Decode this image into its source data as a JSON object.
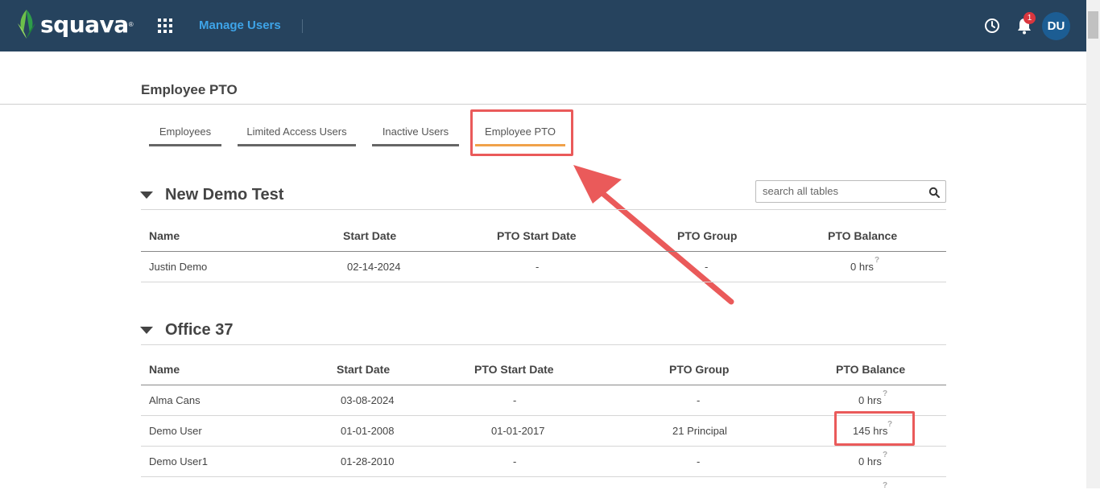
{
  "header": {
    "brand": "squava",
    "nav_label": "Manage Users",
    "notification_count": "1",
    "avatar_initials": "DU",
    "colors": {
      "bar": "#26435e",
      "nav_link": "#3ea4e8",
      "badge": "#d9363e",
      "avatar": "#1c5d93"
    }
  },
  "page": {
    "title": "Employee PTO"
  },
  "tabs": [
    {
      "label": "Employees"
    },
    {
      "label": "Limited Access Users"
    },
    {
      "label": "Inactive Users"
    },
    {
      "label": "Employee PTO",
      "active": true
    }
  ],
  "search": {
    "placeholder": "search all tables"
  },
  "sections": [
    {
      "title": "New Demo Test",
      "columns": [
        "Name",
        "Start Date",
        "PTO Start Date",
        "PTO Group",
        "PTO Balance"
      ],
      "rows": [
        [
          "Justin Demo",
          "02-14-2024",
          "-",
          "-",
          "0 hrs"
        ]
      ]
    },
    {
      "title": "Office 37",
      "columns": [
        "Name",
        "Start Date",
        "PTO Start Date",
        "PTO Group",
        "PTO Balance"
      ],
      "rows": [
        [
          "Alma Cans",
          "03-08-2024",
          "-",
          "-",
          "0 hrs"
        ],
        [
          "Demo User",
          "01-01-2008",
          "01-01-2017",
          "21 Principal",
          "145 hrs"
        ],
        [
          "Demo User1",
          "01-28-2010",
          "-",
          "-",
          "0 hrs"
        ]
      ]
    }
  ],
  "help_mark": "?",
  "annotation_color": "#ea5a5a",
  "active_tab_color": "#f0a24a"
}
